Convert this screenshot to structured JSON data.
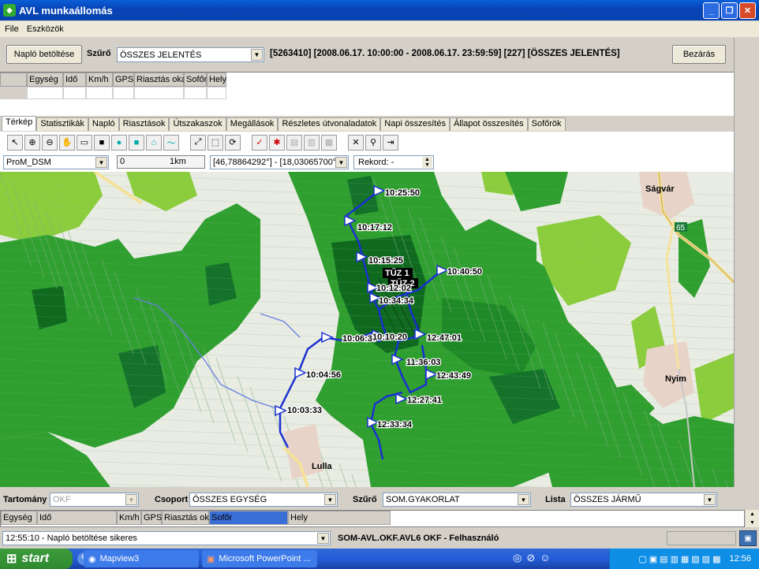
{
  "window": {
    "title": "AVL munkaállomás"
  },
  "menu": [
    {
      "label": "File"
    },
    {
      "label": "Eszközök"
    }
  ],
  "toolbar": {
    "load_log_label": "Napló betöltése",
    "filter_label": "Szűrő",
    "filter_value": "ÖSSZES JELENTÉS",
    "info_text": "[5263410] [2008.06.17. 10:00:00 - 2008.06.17. 23:59:59] [227] [ÖSSZES JELENTÉS]",
    "close_label": "Bezárás"
  },
  "top_grid": {
    "columns": [
      "",
      "Egység",
      "Idő",
      "Km/h",
      "GPS",
      "Riasztás oka",
      "Sofőr",
      "Hely"
    ]
  },
  "tabs": [
    "Térkép",
    "Statisztikák",
    "Napló",
    "Riasztások",
    "Útszakaszok",
    "Megállások",
    "Részletes útvonaladatok",
    "Napi összesítés",
    "Állapot összesítés",
    "Sofőrök"
  ],
  "active_tab": "Térkép",
  "map_controls": {
    "layer_select": "ProM_DSM",
    "scale_start": "0",
    "scale_label": "1km",
    "coordinates": "[46,78864292°] - [18,03065700°]",
    "record_label": "Rekord: -"
  },
  "map": {
    "places": [
      "Ságvár",
      "Nyim",
      "Lulla",
      "65"
    ],
    "fire_labels": [
      "TŰZ 1",
      "TŰZ 2"
    ],
    "track_times": [
      "10:25:50",
      "10:17:12",
      "10:15:25",
      "10:40:50",
      "10:12:02",
      "10:34:34",
      "10:06:37",
      "10:10:20",
      "12:47:01",
      "11:36:03",
      "10:04:56",
      "12:43:49",
      "12:27:41",
      "10:03:33",
      "12:33:34"
    ],
    "colors": {
      "forest": "#2e9e2e",
      "dark_forest": "#0f6a1f",
      "light_green": "#8bcd3c",
      "track": "#1a30d0",
      "water": "#6a7fe0",
      "road": "#f5e29a",
      "village": "#e8d3c8"
    }
  },
  "bottom_filters": {
    "domain_label": "Tartomány",
    "domain_value": "OKF",
    "group_label": "Csoport",
    "group_value": "ÖSSZES EGYSÉG",
    "filter_label": "Szűrő",
    "filter_value": "SOM.GYAKORLAT",
    "list_label": "Lista",
    "list_value": "ÖSSZES JÁRMŰ"
  },
  "bottom_grid": {
    "columns": [
      "Egység",
      "Idő",
      "Km/h",
      "GPS",
      "Riasztás oka",
      "Sofőr",
      "Hely"
    ]
  },
  "status": {
    "message": "12:55:10 - Napló betöltése sikeres",
    "user": "SOM-AVL.OKF.AVL6 OKF - Felhasználó"
  },
  "taskbar": {
    "start_label": "start",
    "tasks": [
      "Mapview3",
      "Microsoft PowerPoint ..."
    ],
    "clock": "12:56"
  }
}
